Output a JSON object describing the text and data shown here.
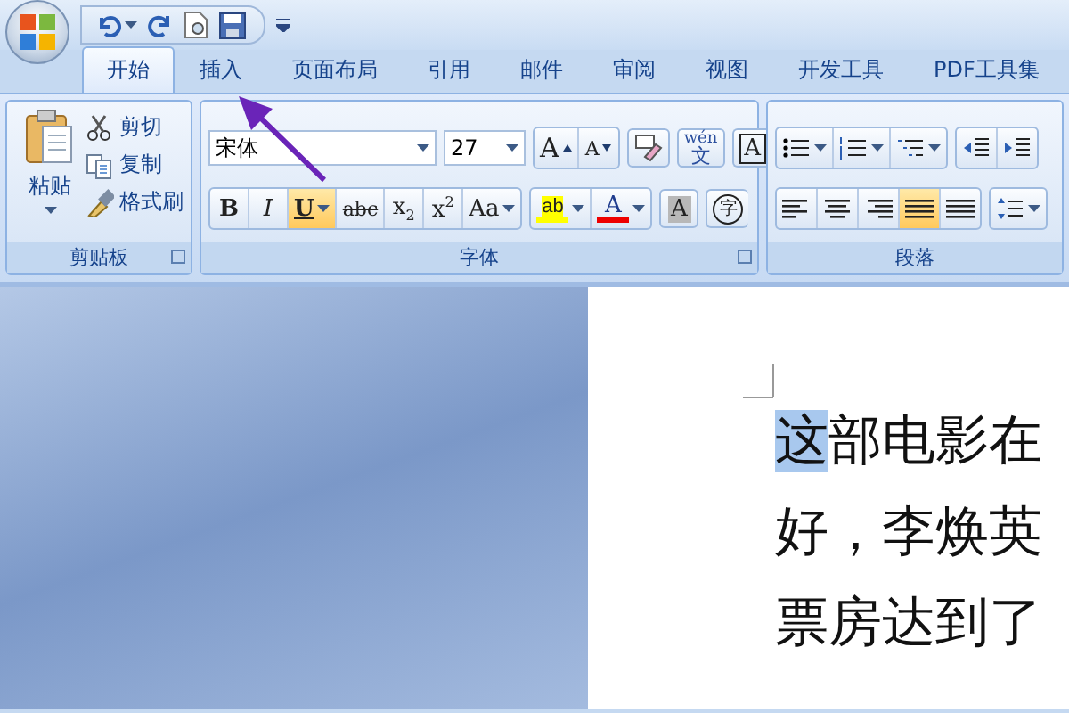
{
  "tabs": [
    {
      "label": "开始",
      "selected": true
    },
    {
      "label": "插入",
      "selected": false
    },
    {
      "label": "页面布局",
      "selected": false
    },
    {
      "label": "引用",
      "selected": false
    },
    {
      "label": "邮件",
      "selected": false
    },
    {
      "label": "审阅",
      "selected": false
    },
    {
      "label": "视图",
      "selected": false
    },
    {
      "label": "开发工具",
      "selected": false
    },
    {
      "label": "PDF工具集",
      "selected": false
    }
  ],
  "clipboard": {
    "paste": "粘贴",
    "items": [
      {
        "kind": "cut",
        "label": "剪切"
      },
      {
        "kind": "copy",
        "label": "复制"
      },
      {
        "kind": "painter",
        "label": "格式刷"
      }
    ],
    "label": "剪贴板"
  },
  "font": {
    "name": "宋体",
    "size": "27",
    "label": "字体",
    "row1": [
      {
        "kind": "grow",
        "label": "A"
      },
      {
        "kind": "shrink",
        "label": "A"
      },
      {
        "kind": "clear"
      },
      {
        "kind": "phonetic",
        "top": "wén",
        "label": "文"
      },
      {
        "kind": "border",
        "label": "A"
      }
    ],
    "row2": [
      {
        "kind": "bold",
        "label": "B",
        "on": false
      },
      {
        "kind": "italic",
        "label": "I",
        "on": false
      },
      {
        "kind": "underline",
        "label": "U",
        "on": true
      },
      {
        "kind": "strike",
        "label": "abc",
        "on": false
      },
      {
        "kind": "sub",
        "label": "x$_{2}$",
        "on": false
      },
      {
        "kind": "sup",
        "label": "x$^{2}$",
        "on": false
      },
      {
        "kind": "case",
        "label": "Aa",
        "on": false
      },
      {
        "kind": "highlight",
        "label": "ab",
        "on": false
      },
      {
        "kind": "color",
        "label": "A",
        "on": false
      },
      {
        "kind": "shading",
        "label": "A",
        "on": false
      },
      {
        "kind": "enclose",
        "label": "字",
        "on": false
      }
    ]
  },
  "paragraph": {
    "label": "段落",
    "align": [
      {
        "kind": "left",
        "on": false
      },
      {
        "kind": "center",
        "on": false
      },
      {
        "kind": "right",
        "on": false
      },
      {
        "kind": "justify",
        "on": true
      },
      {
        "kind": "distributed",
        "on": false
      }
    ]
  },
  "document": {
    "lines": [
      {
        "segments": [
          {
            "text": "这",
            "selected": true
          },
          {
            "text": "部电影在",
            "selected": false
          }
        ]
      },
      {
        "segments": [
          {
            "text": "好，李焕英",
            "selected": false
          }
        ]
      },
      {
        "segments": [
          {
            "text": "票房达到了",
            "selected": false
          }
        ]
      }
    ]
  }
}
